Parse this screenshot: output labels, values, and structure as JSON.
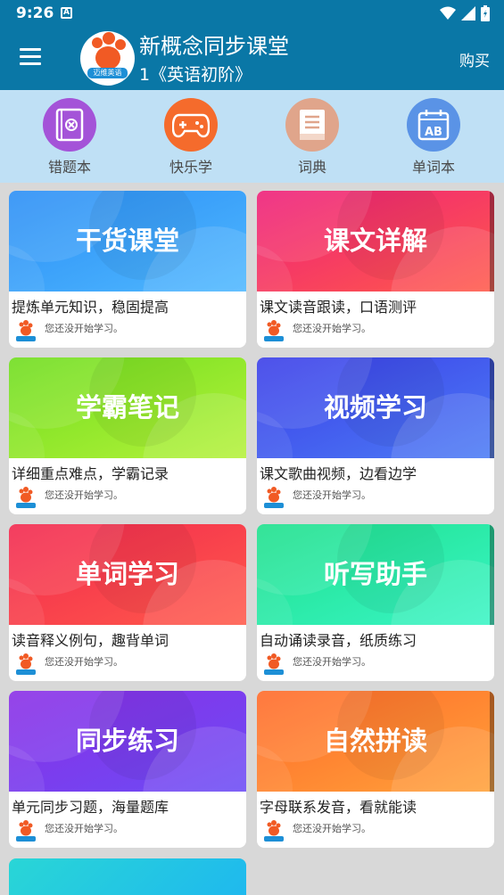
{
  "status_bar": {
    "time": "9:26",
    "notification_letter": "A"
  },
  "app_bar": {
    "title": "新概念同步课堂",
    "subtitle": "1《英语初阶》",
    "buy_label": "购买",
    "logo_badge": "迈维英语"
  },
  "quick_actions": [
    {
      "label": "错题本",
      "icon": "wrong-book-icon",
      "color": "#a453d8"
    },
    {
      "label": "快乐学",
      "icon": "gamepad-icon",
      "color": "#f56b2c"
    },
    {
      "label": "词典",
      "icon": "book-icon",
      "color": "#e0a58b"
    },
    {
      "label": "单词本",
      "icon": "calendar-ab-icon",
      "color": "#5a93e6"
    }
  ],
  "cards": [
    {
      "name": "干货课堂",
      "desc": "提炼单元知识，稳固提高",
      "status": "您还没开始学习。",
      "colors": [
        "#2b8ef5",
        "#4fb8ff"
      ]
    },
    {
      "name": "课文详解",
      "desc": "课文读音跟读，口语测评",
      "status": "您还没开始学习。",
      "colors": [
        "#ee1f7a",
        "#ff5a4a"
      ]
    },
    {
      "name": "学霸笔记",
      "desc": "详细重点难点，学霸记录",
      "status": "您还没开始学习。",
      "colors": [
        "#6fdd1e",
        "#b5f23a"
      ]
    },
    {
      "name": "视频学习",
      "desc": "课文歌曲视频，边看边学",
      "status": "您还没开始学习。",
      "colors": [
        "#3b3ee8",
        "#4c7cf5"
      ]
    },
    {
      "name": "单词学习",
      "desc": "读音释义例句，趣背单词",
      "status": "您还没开始学习。",
      "colors": [
        "#f2284f",
        "#ff5a4a"
      ]
    },
    {
      "name": "听写助手",
      "desc": "自动诵读录音，纸质练习",
      "status": "您还没开始学习。",
      "colors": [
        "#1ee08c",
        "#3af5c6"
      ]
    },
    {
      "name": "同步练习",
      "desc": "单元同步习题，海量题库",
      "status": "您还没开始学习。",
      "colors": [
        "#8a2ee6",
        "#6c4cf5"
      ]
    },
    {
      "name": "自然拼读",
      "desc": "字母联系发音，看就能读",
      "status": "您还没开始学习。",
      "colors": [
        "#ff6a2a",
        "#ffa23a"
      ]
    }
  ]
}
